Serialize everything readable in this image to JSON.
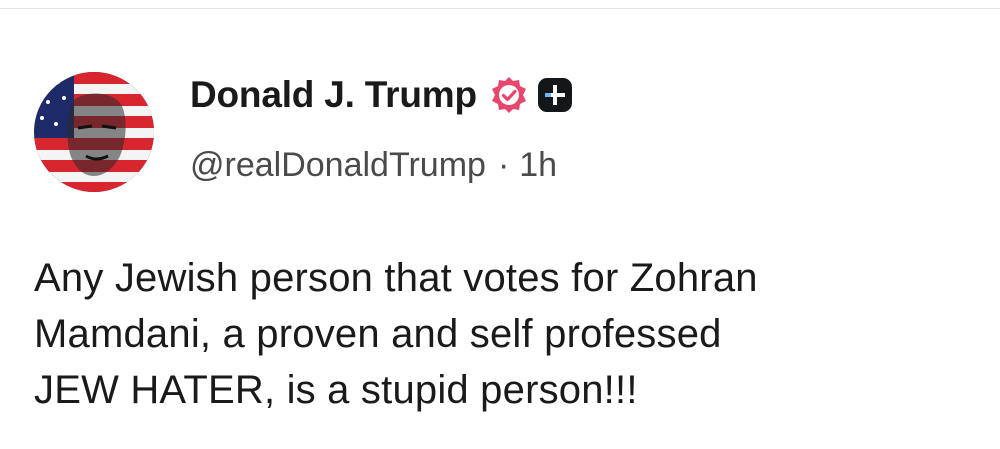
{
  "post": {
    "author": {
      "display_name": "Donald J. Trump",
      "handle": "@realDonaldTrump",
      "separator": "·",
      "timestamp": "1h",
      "avatar_icon": "flag-portrait-avatar",
      "verified_icon": "verified-badge-icon",
      "verified_color": "#e8476d",
      "extra_badge_icon": "plus-badge-icon"
    },
    "text_lines": [
      "Any Jewish person that votes for Zohran",
      "Mamdani, a proven and self professed",
      "JEW HATER, is a stupid person!!!"
    ]
  }
}
